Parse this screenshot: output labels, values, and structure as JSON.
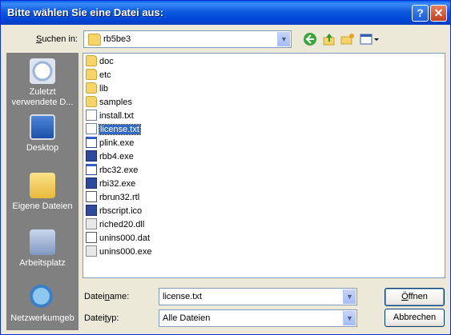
{
  "window": {
    "title": "Bitte wählen Sie eine Datei aus:"
  },
  "titlebar": {
    "help_label": "?",
    "close_label": "✕"
  },
  "lookin": {
    "label_prefix": "S",
    "label_rest": "uchen in:",
    "value": "rb5be3"
  },
  "places": [
    {
      "name": "recent",
      "label": "Zuletzt verwendete D..."
    },
    {
      "name": "desktop",
      "label": "Desktop"
    },
    {
      "name": "my-documents",
      "label": "Eigene Dateien"
    },
    {
      "name": "my-computer",
      "label": "Arbeitsplatz"
    },
    {
      "name": "network",
      "label": "Netzwerkumgeb"
    }
  ],
  "files": [
    {
      "name": "doc",
      "icon": "folder-icon"
    },
    {
      "name": "etc",
      "icon": "folder-icon"
    },
    {
      "name": "lib",
      "icon": "folder-icon"
    },
    {
      "name": "samples",
      "icon": "folder-icon"
    },
    {
      "name": "install.txt",
      "icon": "text-file-icon"
    },
    {
      "name": "license.txt",
      "icon": "text-file-icon",
      "selected": true
    },
    {
      "name": "plink.exe",
      "icon": "exe-icon"
    },
    {
      "name": "rbb4.exe",
      "icon": "rb-exe-icon"
    },
    {
      "name": "rbc32.exe",
      "icon": "exe-icon"
    },
    {
      "name": "rbi32.exe",
      "icon": "rb-exe-icon"
    },
    {
      "name": "rbrun32.rtl",
      "icon": "rtl-file-icon"
    },
    {
      "name": "rbscript.ico",
      "icon": "ico-file-icon"
    },
    {
      "name": "riched20.dll",
      "icon": "dll-icon"
    },
    {
      "name": "unins000.dat",
      "icon": "dat-file-icon"
    },
    {
      "name": "unins000.exe",
      "icon": "installer-icon"
    }
  ],
  "filename": {
    "label_a": "Datei",
    "label_u": "n",
    "label_b": "ame:",
    "value": "license.txt"
  },
  "filetype": {
    "label_a": "Datei",
    "label_u": "t",
    "label_b": "yp:",
    "value": "Alle Dateien"
  },
  "buttons": {
    "open_u": "Ö",
    "open_rest": "ffnen",
    "cancel": "Abbrechen"
  },
  "colors": {
    "title_bar": "#0054E3",
    "selection": "#316AC5",
    "places_bar": "#808080"
  }
}
